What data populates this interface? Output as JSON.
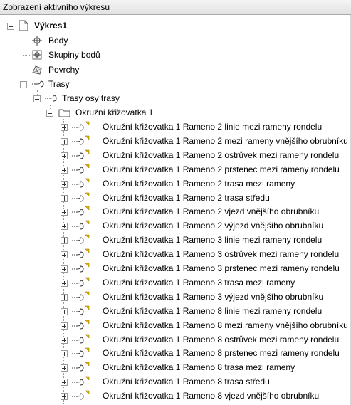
{
  "panel": {
    "title": "Zobrazení aktivního výkresu"
  },
  "tree": {
    "root": {
      "label": "Výkres1",
      "icon": "drawing-page-icon"
    },
    "body": {
      "label": "Body",
      "icon": "point-icon"
    },
    "skupiny": {
      "label": "Skupiny bodů",
      "icon": "point-group-icon"
    },
    "povrchy": {
      "label": "Povrchy",
      "icon": "surface-icon"
    },
    "trasy": {
      "label": "Trasy",
      "icon": "alignment-icon"
    },
    "trasy_osy": {
      "label": "Trasy osy trasy",
      "icon": "alignment-icon"
    },
    "folder": {
      "label": "Okružní křižovatka 1",
      "icon": "folder-icon"
    },
    "items": [
      "Okružní křižovatka 1 Rameno 2 linie mezi rameny rondelu",
      "Okružní křižovatka 1 Rameno 2 mezi rameny vnějšího obrubníku",
      "Okružní křižovatka 1 Rameno 2 ostrůvek mezi rameny rondelu",
      "Okružní křižovatka 1 Rameno 2 prstenec mezi rameny rondelu",
      "Okružní křižovatka 1 Rameno 2 trasa mezi rameny",
      "Okružní křižovatka 1 Rameno 2 trasa středu",
      "Okružní křižovatka 1 Rameno 2 vjezd vnějšího obrubníku",
      "Okružní křižovatka 1 Rameno 2 výjezd vnějšího obrubníku",
      "Okružní křižovatka 1 Rameno 3 linie mezi rameny rondelu",
      "Okružní křižovatka 1 Rameno 3 ostrůvek mezi rameny rondelu",
      "Okružní křižovatka 1 Rameno 3 prstenec mezi rameny rondelu",
      "Okružní křižovatka 1 Rameno 3 trasa mezi rameny",
      "Okružní křižovatka 1 Rameno 3 výjezd vnějšího obrubníku",
      "Okružní křižovatka 1 Rameno 8 linie mezi rameny rondelu",
      "Okružní křižovatka 1 Rameno 8 mezi rameny vnějšího obrubníku",
      "Okružní křižovatka 1 Rameno 8 ostrůvek mezi rameny rondelu",
      "Okružní křižovatka 1 Rameno 8 prstenec mezi rameny rondelu",
      "Okružní křižovatka 1 Rameno 8 trasa mezi rameny",
      "Okružní křižovatka 1 Rameno 8 trasa středu",
      "Okružní křižovatka 1 Rameno 8 vjezd vnějšího obrubníku"
    ],
    "item_icon": "alignment-with-warning-icon",
    "warning_color": "#e8b400"
  }
}
